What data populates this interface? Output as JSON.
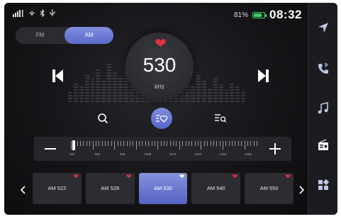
{
  "status": {
    "icons": [
      "signal-icon",
      "hotspot-icon",
      "bluetooth-icon",
      "usb-icon"
    ],
    "battery_percent": "81%",
    "battery_level": 0.81,
    "time": "08:32"
  },
  "band": {
    "options": [
      "FM",
      "AM"
    ],
    "selected": "AM"
  },
  "station": {
    "frequency": "530",
    "unit": "kHz",
    "favorite": true
  },
  "tuner": {
    "labels": [
      "522",
      "684",
      "846",
      "1008",
      "1170",
      "1332",
      "1494",
      "1656"
    ],
    "min": 522,
    "max": 1710,
    "current": 530
  },
  "presets": [
    {
      "label": "AM 522",
      "favorite": true,
      "active": false
    },
    {
      "label": "AM 528",
      "favorite": true,
      "active": false
    },
    {
      "label": "AM 530",
      "favorite": true,
      "active": true
    },
    {
      "label": "AM 540",
      "favorite": true,
      "active": false
    },
    {
      "label": "AM 550",
      "favorite": true,
      "active": false
    }
  ],
  "sidebar": {
    "items": [
      {
        "name": "navigation-icon",
        "active": false
      },
      {
        "name": "bluetooth-phone-icon",
        "active": false
      },
      {
        "name": "music-icon",
        "active": false
      },
      {
        "name": "radio-icon",
        "active": true
      },
      {
        "name": "apps-icon",
        "active": false
      }
    ]
  },
  "colors": {
    "accent": "#6676cf",
    "heart": "#e3323c",
    "battery": "#3ad06a"
  }
}
